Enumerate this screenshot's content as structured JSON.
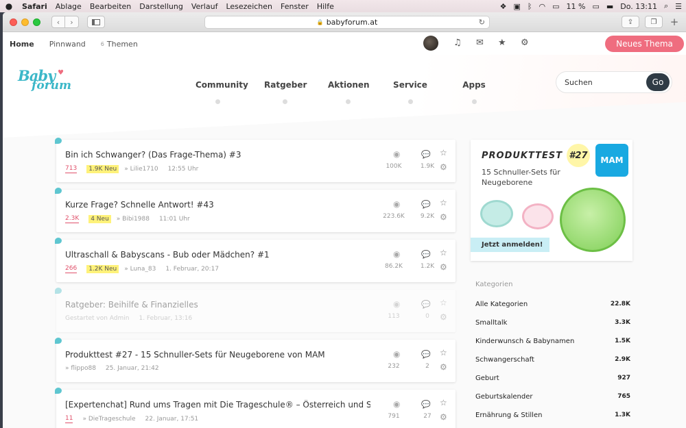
{
  "menubar": {
    "apple": "",
    "app": "Safari",
    "items": [
      "Ablage",
      "Bearbeiten",
      "Darstellung",
      "Verlauf",
      "Lesezeichen",
      "Fenster",
      "Hilfe"
    ],
    "battery": "11 %",
    "clock": "Do. 13:11"
  },
  "browser": {
    "url": "babyforum.at"
  },
  "topnav": {
    "home": "Home",
    "pinnwand": "Pinnwand",
    "themen_count": "6",
    "themen": "Themen",
    "new_topic": "Neues Thema"
  },
  "logo": {
    "line1": "Baby",
    "line2": "forum"
  },
  "mainnav": [
    "Community",
    "Ratgeber",
    "Aktionen",
    "Service",
    "Apps"
  ],
  "search": {
    "placeholder": "Suchen",
    "go": "Go"
  },
  "threads": [
    {
      "title": "Bin ich Schwanger? (Das Frage-Thema) #3",
      "replies": "713",
      "new": "1.9K Neu",
      "author": "» Lilie1710",
      "time": "12:55 Uhr",
      "views": "100K",
      "reply_count": "1.9K"
    },
    {
      "title": "Kurze Frage? Schnelle Antwort! #43",
      "replies": "2.3K",
      "new": "4 Neu",
      "author": "» Bibi1988",
      "time": "11:01 Uhr",
      "views": "223.6K",
      "reply_count": "9.2K"
    },
    {
      "title": "Ultraschall & Babyscans - Bub oder Mädchen? #1",
      "replies": "266",
      "new": "1.2K Neu",
      "author": "» Luna_83",
      "time": "1. Februar, 20:17",
      "views": "86.2K",
      "reply_count": "1.2K"
    },
    {
      "title": "Ratgeber: Beihilfe & Finanzielles",
      "started": "Gestartet von Admin",
      "time": "1. Februar, 13:16",
      "views": "113",
      "reply_count": "0"
    },
    {
      "title": "Produkttest #27 - 15 Schnuller-Sets für Neugeborene von MAM",
      "author": "» flippo88",
      "time": "25. Januar, 21:42",
      "views": "232",
      "reply_count": "2"
    },
    {
      "title": "[Expertenchat] Rund ums Tragen mit Die Trageschule® – Österreich und Schweiz",
      "replies": "11",
      "author": "» DieTrageschule",
      "time": "22. Januar, 17:51",
      "views": "791",
      "reply_count": "27"
    }
  ],
  "ad": {
    "title": "PRODUKTTEST",
    "number": "#27",
    "subtitle": "15 Schnuller-Sets für Neugeborene",
    "brand": "MAM",
    "cta": "Jetzt anmelden!"
  },
  "categories": {
    "heading": "Kategorien",
    "items": [
      {
        "name": "Alle Kategorien",
        "count": "22.8K"
      },
      {
        "name": "Smalltalk",
        "count": "3.3K"
      },
      {
        "name": "Kinderwunsch & Babynamen",
        "count": "1.5K"
      },
      {
        "name": "Schwangerschaft",
        "count": "2.9K"
      },
      {
        "name": "Geburt",
        "count": "927"
      },
      {
        "name": "Geburtskalender",
        "count": "765"
      },
      {
        "name": "Ernährung & Stillen",
        "count": "1.3K"
      }
    ]
  }
}
